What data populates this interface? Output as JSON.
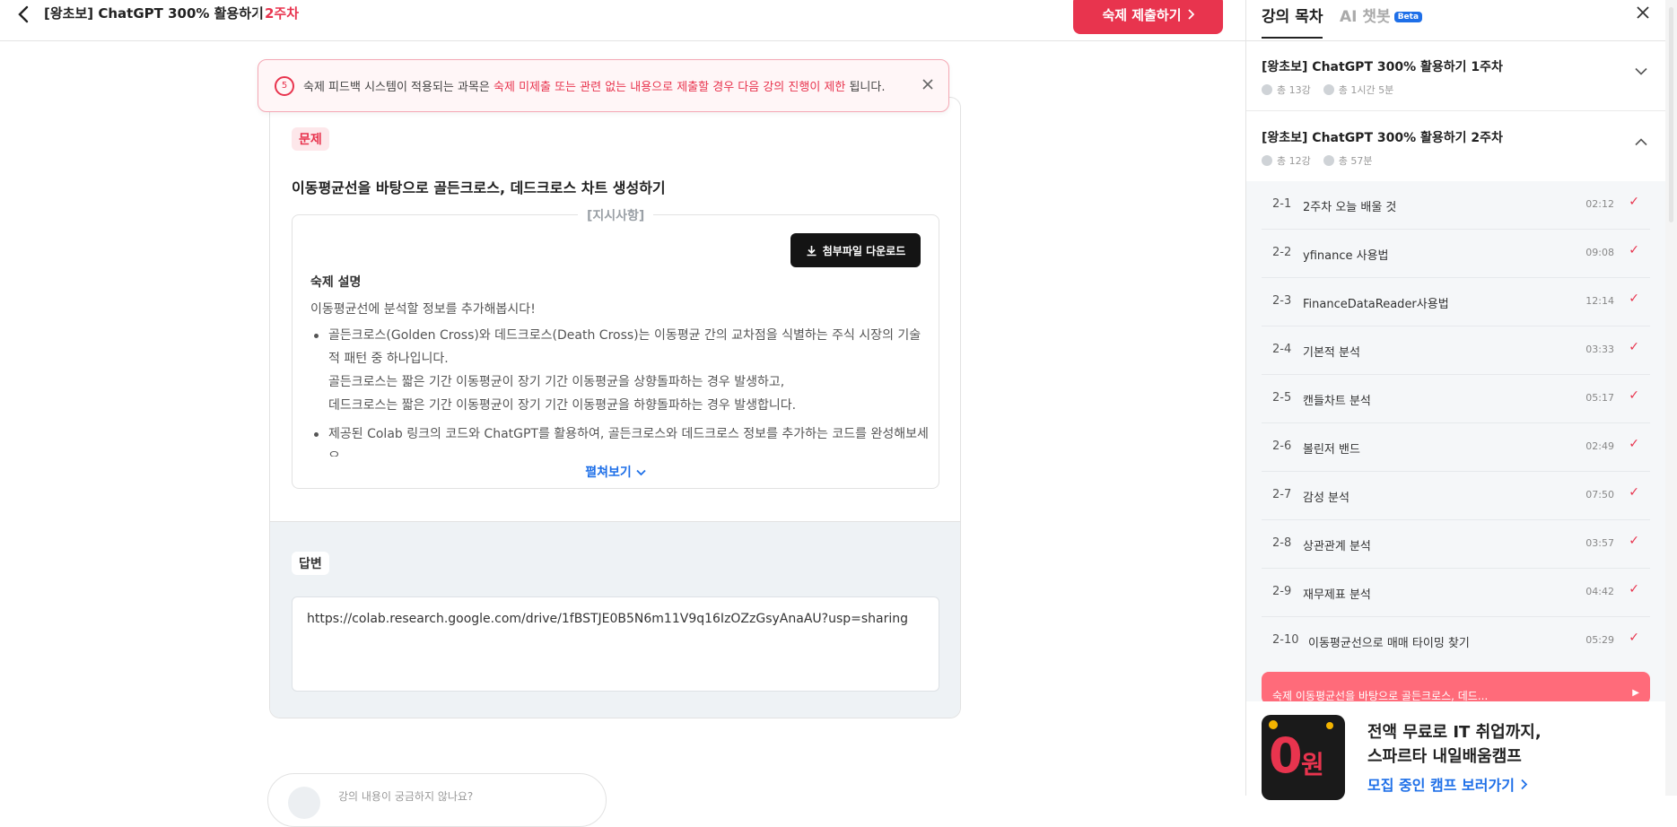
{
  "header": {
    "course_title": "[왕초보] ChatGPT 300% 활용하기",
    "week_label": "2주차",
    "submit_label": "숙제 제출하기"
  },
  "notice": {
    "count": "5",
    "text_before": "숙제 피드백 시스템이 적용되는 과목은 ",
    "text_highlight": "숙제 미제출 또는 관련 없는 내용으로 제출할 경우 다음 강의 진행이 제한",
    "text_after": " 됩니다."
  },
  "problem": {
    "tag": "문제",
    "title": "이동평균선을 바탕으로 골든크로스, 데드크로스 차트 생성하기",
    "instructions_label": "[지시사항]",
    "download_label": "첨부파일 다운로드",
    "heading": "숙제 설명",
    "intro": "이동평균선에 분석할 정보를 추가해봅시다!",
    "bullets": [
      {
        "lines": [
          "골든크로스(Golden Cross)와 데드크로스(Death Cross)는 이동평균 간의 교차점을 식별하는 주식 시장의 기술적 패턴 중 하나입니다.",
          "골든크로스는 짧은 기간 이동평균이 장기 기간 이동평균을 상향돌파하는 경우 발생하고,",
          "데드크로스는 짧은 기간 이동평균이 장기 기간 이동평균을 하향돌파하는 경우 발생합니다."
        ]
      },
      {
        "lines": [
          "제공된 Colab 링크의 코드와 ChatGPT를 활용하여, 골든크로스와 데드크로스 정보를 추가하는 코드를 완성해보세요."
        ]
      }
    ],
    "expand_label": "펼쳐보기"
  },
  "answer": {
    "tag": "답변",
    "value": "https://colab.research.google.com/drive/1fBSTJE0B5N6m11V9q16IzOZzGsyAnaAU?usp=sharing"
  },
  "bottom_prompt": "강의 내용이 궁금하지 않나요?",
  "sidebar": {
    "tab_toc": "강의 목차",
    "tab_ai": "AI 챗봇",
    "beta": "Beta",
    "weeks": [
      {
        "title": "[왕초보] ChatGPT 300% 활용하기 1주차",
        "lessons": "총 13강",
        "duration": "총 1시간 5분"
      },
      {
        "title": "[왕초보] ChatGPT 300% 활용하기 2주차",
        "lessons": "총 12강",
        "duration": "총 57분"
      }
    ],
    "lessons": [
      {
        "no": "2-1",
        "name": "2주차 오늘 배울 것",
        "time": "02:12"
      },
      {
        "no": "2-2",
        "name": "yfinance 사용법",
        "time": "09:08"
      },
      {
        "no": "2-3",
        "name": "FinanceDataReader사용법",
        "time": "12:14"
      },
      {
        "no": "2-4",
        "name": "기본적 분석",
        "time": "03:33"
      },
      {
        "no": "2-5",
        "name": "캔들차트 분석",
        "time": "05:17"
      },
      {
        "no": "2-6",
        "name": "볼린저 밴드",
        "time": "02:49"
      },
      {
        "no": "2-7",
        "name": "감성 분석",
        "time": "07:50"
      },
      {
        "no": "2-8",
        "name": "상관관계 분석",
        "time": "03:57"
      },
      {
        "no": "2-9",
        "name": "재무제표 분석",
        "time": "04:42"
      },
      {
        "no": "2-10",
        "name": "이동평균선으로 매매 타이밍 찾기",
        "time": "05:29"
      }
    ],
    "homework_row": "숙제  이동평균선을 바탕으로 골든크로스, 데드...",
    "promo": {
      "image_text_zero": "0",
      "image_text_won": "원",
      "line1": "전액 무료로 IT 취업까지,",
      "line2": "스파르타 내일배움캠프",
      "link": "모집 중인 캠프 보러가기"
    }
  },
  "colors": {
    "accent": "#e8344e",
    "link": "#1e6fe8"
  }
}
